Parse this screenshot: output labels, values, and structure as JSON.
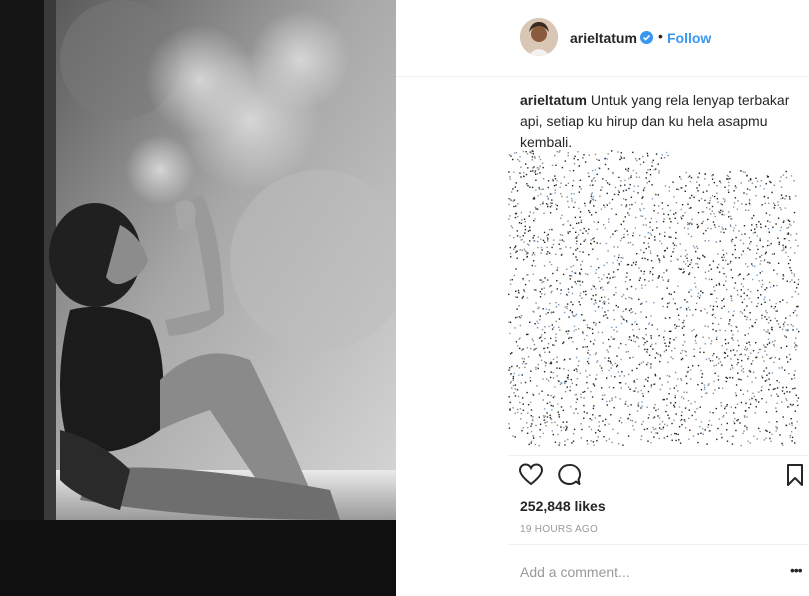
{
  "post": {
    "username": "arieltatum",
    "follow_label": "Follow",
    "dot_separator": "•",
    "caption_user": "arieltatum",
    "caption_text": "Untuk yang rela lenyap terbakar api, setiap ku hirup dan ku hela asapmu kembali.",
    "likes": "252,848 likes",
    "timestamp": "19 HOURS AGO",
    "comment_placeholder": "Add a comment...",
    "more_label": "•••"
  },
  "icons": {
    "verified": "verified-badge-icon",
    "like": "heart-icon",
    "comment": "comment-bubble-icon",
    "save": "bookmark-icon",
    "more": "more-options-icon"
  },
  "colors": {
    "accent": "#3897f0",
    "text": "#262626",
    "muted": "#999999",
    "divider": "#efefef"
  }
}
